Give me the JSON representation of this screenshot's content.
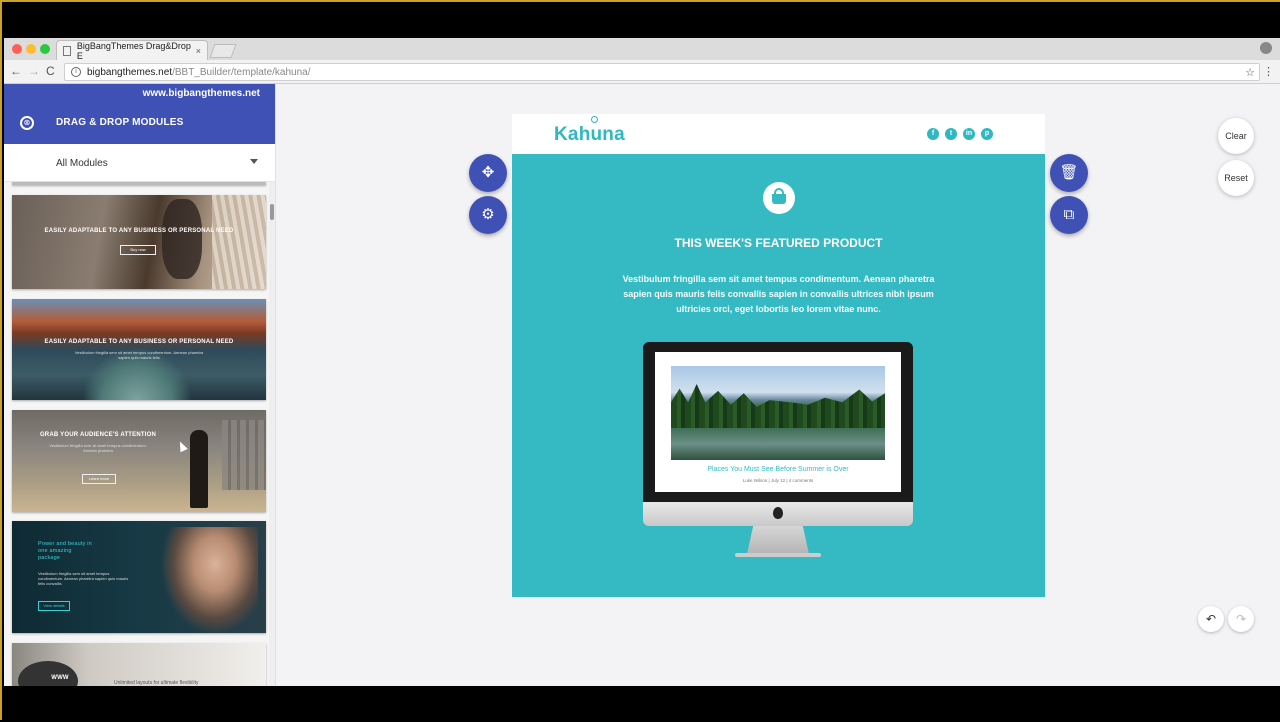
{
  "browser": {
    "tab_title": "BigBangThemes Drag&Drop E",
    "tab_close": "×",
    "url_host": "bigbangthemes.net",
    "url_path": "/BBT_Builder/template/kahuna/",
    "back": "←",
    "forward": "→",
    "reload": "C",
    "star": "☆",
    "menu": "⋮"
  },
  "sidebar": {
    "site": "www.bigbangthemes.net",
    "close_icon": "⊗",
    "title": "DRAG & DROP MODULES",
    "filter": "All Modules",
    "thumbnails": [
      {
        "caption": "EASILY ADAPTABLE TO ANY BUSINESS OR PERSONAL NEED",
        "button": "Buy now"
      },
      {
        "caption": "EASILY ADAPTABLE TO ANY BUSINESS OR PERSONAL NEED",
        "sub": "Vestibulum fringilla sem sit amet tempus condimentum. Aenean pharetra sapien quis mauris felis"
      },
      {
        "caption": "GRAB YOUR AUDIENCE'S ATTENTION",
        "sub": "Vestibulum fringilla sem sit amet tempus condimentum. Aenean pharetra",
        "button": "Learn more"
      },
      {
        "caption": "Power and beauty in one amazing package",
        "sub": "Vestibulum fringilla sem sit amet tempus condimentum. Aenean pharetra sapien quis mauris felis convallis",
        "button": "View details"
      },
      {
        "caption": "Unlimited layouts for ultimate flexibility",
        "brand": "WWW"
      }
    ]
  },
  "template": {
    "logo": "Kahuna",
    "social": [
      "f",
      "t",
      "in",
      "p"
    ],
    "title": "THIS WEEK'S FEATURED PRODUCT",
    "body": "Vestibulum fringilla sem sit amet tempus condimentum. Aenean pharetra sapien quis mauris felis convallis sapien in convallis ultrices nibh ipsum ultricies orci, eget lobortis leo lorem vitae nunc.",
    "monitor_caption": "Places You Must See Before Summer is Over",
    "monitor_meta": "Luke Wilson | July 12 | 4 comments"
  },
  "actions": {
    "move": "✥",
    "settings": "⚙",
    "delete": "🗑",
    "copy": "⧉",
    "clear": "Clear",
    "reset": "Reset",
    "undo": "↶",
    "redo": "↷"
  },
  "colors": {
    "accent": "#3f51b5",
    "teal": "#35bac3"
  }
}
